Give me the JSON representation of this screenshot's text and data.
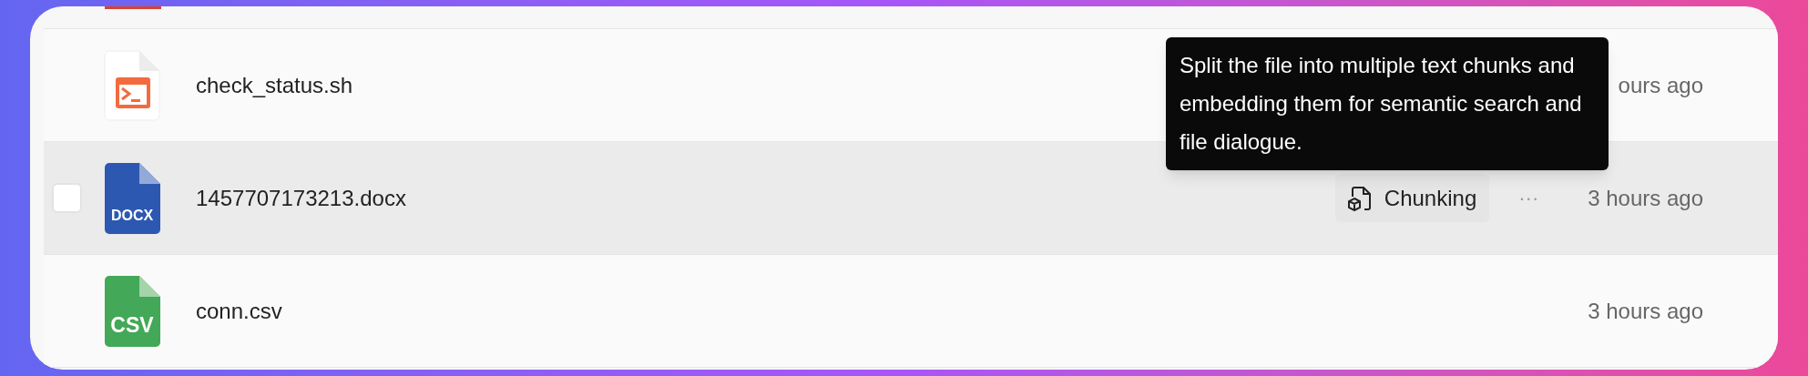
{
  "top_row": {
    "kind": "red-file"
  },
  "rows": [
    {
      "name": "check_status.sh",
      "kind": "sh",
      "time": "ours ago",
      "highlighted": false
    },
    {
      "name": "1457707173213.docx",
      "kind": "docx",
      "icon_label": "DOCX",
      "time": "3 hours ago",
      "highlighted": true,
      "checkbox": {
        "checked": false
      },
      "status": {
        "label": "Chunking"
      },
      "more": "···"
    },
    {
      "name": "conn.csv",
      "kind": "csv",
      "icon_label": "CSV",
      "time": "3 hours ago",
      "highlighted": false
    }
  ],
  "tooltip": {
    "text": "Split the file into multiple text chunks and embedding them for semantic search and file dialogue."
  }
}
